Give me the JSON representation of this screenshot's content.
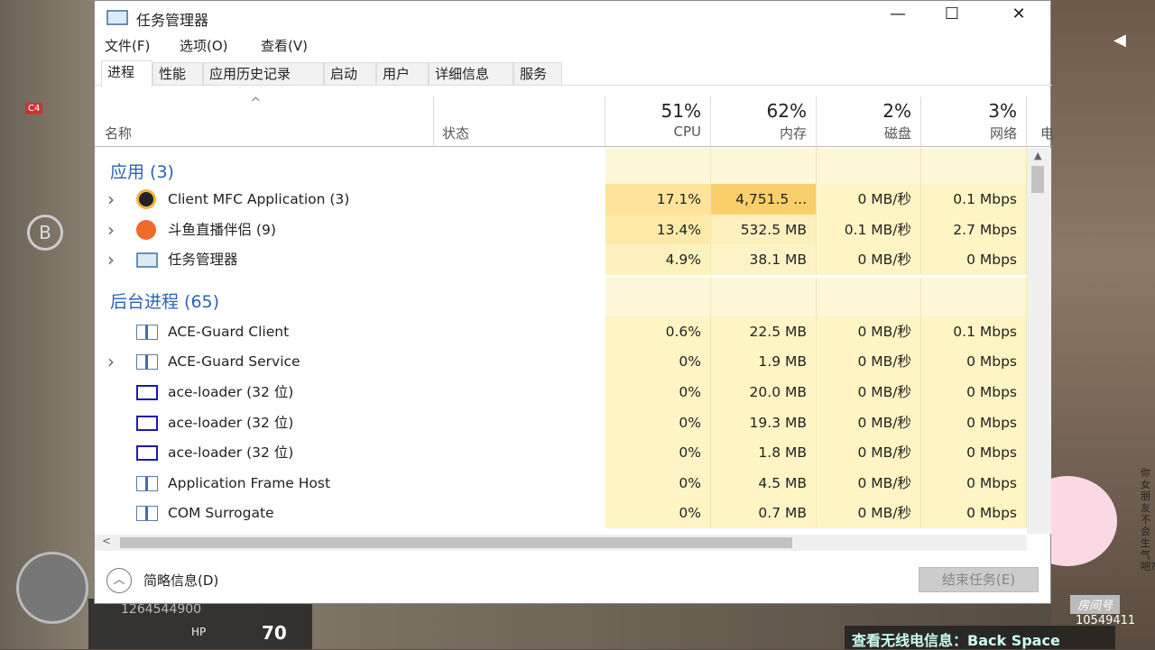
{
  "window": {
    "title": "任务管理器",
    "minimize": "—",
    "maximize": "☐",
    "close": "✕"
  },
  "menu": [
    "文件(F)",
    "选项(O)",
    "查看(V)"
  ],
  "tabs": [
    "进程",
    "性能",
    "应用历史记录",
    "启动",
    "用户",
    "详细信息",
    "服务"
  ],
  "active_tab": 0,
  "columns": {
    "name": "名称",
    "status": "状态",
    "cpu": {
      "pct": "51%",
      "label": "CPU"
    },
    "mem": {
      "pct": "62%",
      "label": "内存"
    },
    "disk": {
      "pct": "2%",
      "label": "磁盘"
    },
    "net": {
      "pct": "3%",
      "label": "网络"
    },
    "power": "电"
  },
  "groups": [
    {
      "title": "应用 (3)",
      "rows": [
        {
          "name": "Client MFC Application (3)",
          "expand": true,
          "icon": "mfc-app-icon",
          "cpu": "17.1%",
          "mem": "4,751.5 ...",
          "disk": "0 MB/秒",
          "net": "0.1 Mbps",
          "cpu_heat": "#fde49a",
          "mem_heat": "#f9cf6c"
        },
        {
          "name": "斗鱼直播伴侣 (9)",
          "expand": true,
          "icon": "douyu-icon",
          "cpu": "13.4%",
          "mem": "532.5 MB",
          "disk": "0.1 MB/秒",
          "net": "2.7 Mbps",
          "cpu_heat": "#fdeaa8",
          "mem_heat": "#fdf0bd"
        },
        {
          "name": "任务管理器",
          "expand": true,
          "icon": "task-manager-icon",
          "cpu": "4.9%",
          "mem": "38.1 MB",
          "disk": "0 MB/秒",
          "net": "0 Mbps",
          "cpu_heat": "#fdf1bd",
          "mem_heat": "#fdf3c6"
        }
      ]
    },
    {
      "title": "后台进程 (65)",
      "rows": [
        {
          "name": "ACE-Guard Client",
          "expand": false,
          "icon": "service-window-icon",
          "cpu": "0.6%",
          "mem": "22.5 MB",
          "disk": "0 MB/秒",
          "net": "0.1 Mbps"
        },
        {
          "name": "ACE-Guard Service",
          "expand": true,
          "icon": "service-window-icon",
          "cpu": "0%",
          "mem": "1.9 MB",
          "disk": "0 MB/秒",
          "net": "0 Mbps"
        },
        {
          "name": "ace-loader (32 位)",
          "expand": false,
          "icon": "blank-window-icon",
          "cpu": "0%",
          "mem": "20.0 MB",
          "disk": "0 MB/秒",
          "net": "0 Mbps"
        },
        {
          "name": "ace-loader (32 位)",
          "expand": false,
          "icon": "blank-window-icon",
          "cpu": "0%",
          "mem": "19.3 MB",
          "disk": "0 MB/秒",
          "net": "0 Mbps"
        },
        {
          "name": "ace-loader (32 位)",
          "expand": false,
          "icon": "blank-window-icon",
          "cpu": "0%",
          "mem": "1.8 MB",
          "disk": "0 MB/秒",
          "net": "0 Mbps"
        },
        {
          "name": "Application Frame Host",
          "expand": false,
          "icon": "service-window-icon",
          "cpu": "0%",
          "mem": "4.5 MB",
          "disk": "0 MB/秒",
          "net": "0 Mbps"
        },
        {
          "name": "COM Surrogate",
          "expand": false,
          "icon": "service-window-icon",
          "cpu": "0%",
          "mem": "0.7 MB",
          "disk": "0 MB/秒",
          "net": "0 Mbps"
        }
      ]
    }
  ],
  "footer": {
    "fewer_details": "简略信息(D)",
    "end_task": "结束任务(E)"
  },
  "overlay": {
    "room_label": "房间号",
    "room_id": "10549411",
    "hint": "查看无线电信息：Back Space",
    "side_text": "你女朋友不会生气吧?",
    "hud_id": "1264544900",
    "hp_label": "HP",
    "hp": "70",
    "c4": "C4",
    "b": "B"
  }
}
